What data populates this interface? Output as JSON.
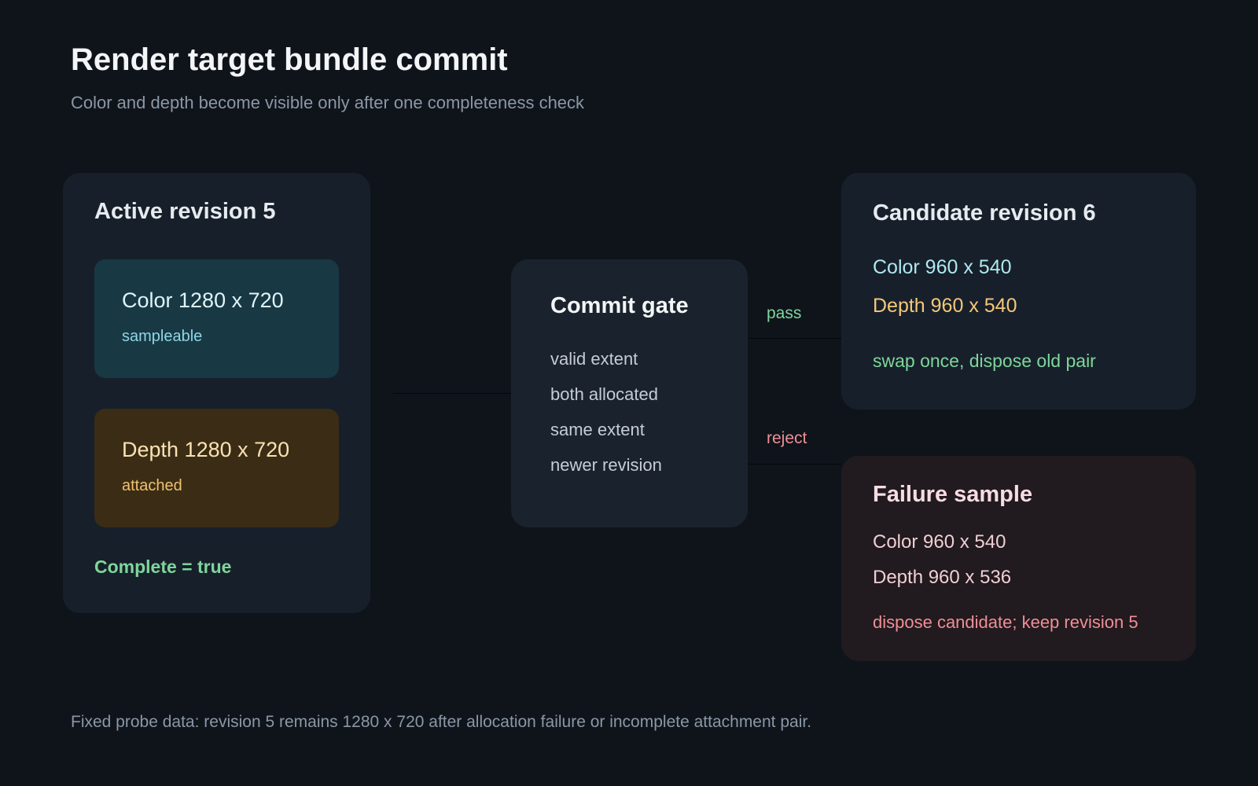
{
  "header": {
    "title": "Render target bundle commit",
    "subtitle": "Color and depth become visible only after one completeness check"
  },
  "active": {
    "title": "Active revision 5",
    "color_label": "Color 1280 x 720",
    "color_state": "sampleable",
    "depth_label": "Depth 1280 x 720",
    "depth_state": "attached",
    "complete": "Complete = true"
  },
  "gate": {
    "title": "Commit gate",
    "checks": [
      "valid extent",
      "both allocated",
      "same extent",
      "newer revision"
    ]
  },
  "edges": {
    "pass": "pass",
    "reject": "reject"
  },
  "candidate": {
    "title": "Candidate revision 6",
    "color": "Color 960 x 540",
    "depth": "Depth 960 x 540",
    "action": "swap once, dispose old pair"
  },
  "failure": {
    "title": "Failure sample",
    "color": "Color 960 x 540",
    "depth": "Depth 960 x 536",
    "action": "dispose candidate; keep revision 5"
  },
  "footer": {
    "note": "Fixed probe data: revision 5 remains 1280 x 720 after allocation failure or incomplete attachment pair."
  },
  "colors": {
    "background": "#0f141b",
    "pass": "#7fd69b",
    "reject": "#ef8f95",
    "color_accent": "#9fe3ee",
    "depth_accent": "#f5c879"
  }
}
